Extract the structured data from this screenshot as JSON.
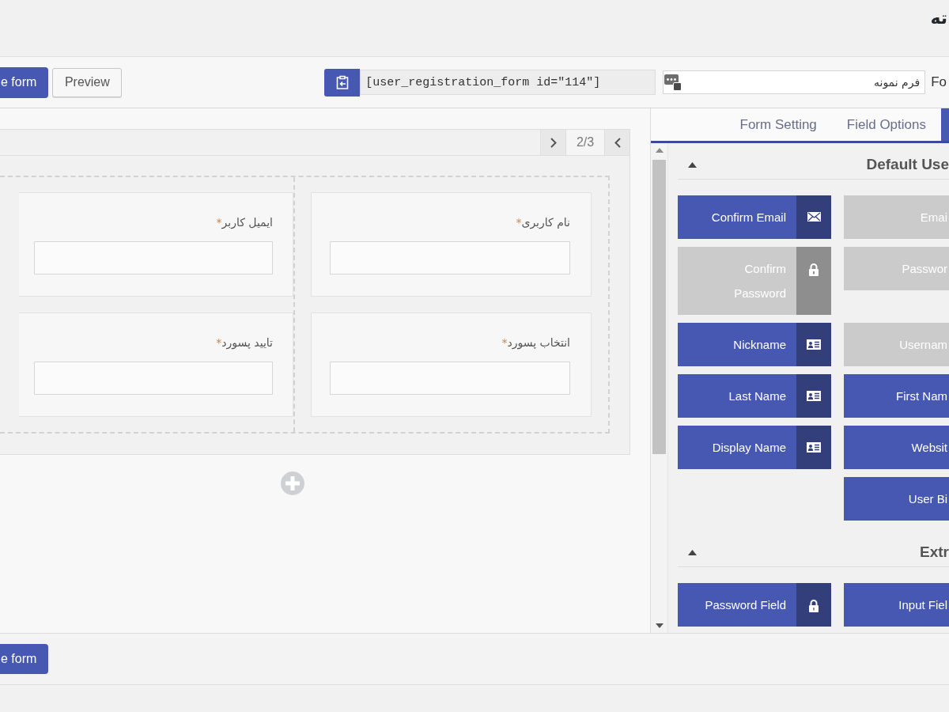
{
  "header": {
    "title": "ته"
  },
  "toolbar": {
    "primary_button": "e form",
    "preview_button": "Preview",
    "shortcode": "[user_registration_form id=\"114\"]",
    "form_name": {
      "value": "فرم نمونه",
      "label": "Fo"
    }
  },
  "canvas": {
    "row": {
      "page_indicator": "2/3",
      "columns": [
        {
          "fields": [
            {
              "label": "نام کاربری",
              "required_mark": "*"
            },
            {
              "label": "انتخاب پسورد",
              "required_mark": "*"
            }
          ]
        },
        {
          "fields": [
            {
              "label": "ایمیل کاربر",
              "required_mark": "*"
            },
            {
              "label": "تایید پسورد",
              "required_mark": "*"
            }
          ]
        }
      ]
    }
  },
  "sidebar": {
    "tabs": [
      {
        "label": "Form Setting",
        "selected": false
      },
      {
        "label": "Field Options",
        "selected": false
      },
      {
        "selected": true
      }
    ],
    "sections": [
      {
        "title": "Default Use",
        "expanded": true,
        "fields": [
          {
            "label": "Confirm Email",
            "disabled": false,
            "kind": "envelope"
          },
          {
            "label": "Emai",
            "disabled": true
          },
          {
            "label": "Confirm Password",
            "disabled": true,
            "kind": "lock"
          },
          {
            "label": "Passwor",
            "disabled": true
          },
          {
            "label": "Nickname",
            "disabled": false,
            "kind": "card"
          },
          {
            "label": "Usernam",
            "disabled": true
          },
          {
            "label": "Last Name",
            "disabled": false,
            "kind": "card"
          },
          {
            "label": "First Nam",
            "disabled": false
          },
          {
            "label": "Display Name",
            "disabled": false,
            "kind": "card"
          },
          {
            "label": "Websit",
            "disabled": false
          },
          {
            "label": "User Bi",
            "disabled": false
          }
        ]
      },
      {
        "title": "Extr",
        "expanded": true,
        "fields": [
          {
            "label": "Password Field",
            "disabled": false,
            "kind": "lock"
          },
          {
            "label": "Input Fiel",
            "disabled": false
          }
        ]
      }
    ]
  },
  "footer": {
    "primary_button": "e form"
  }
}
